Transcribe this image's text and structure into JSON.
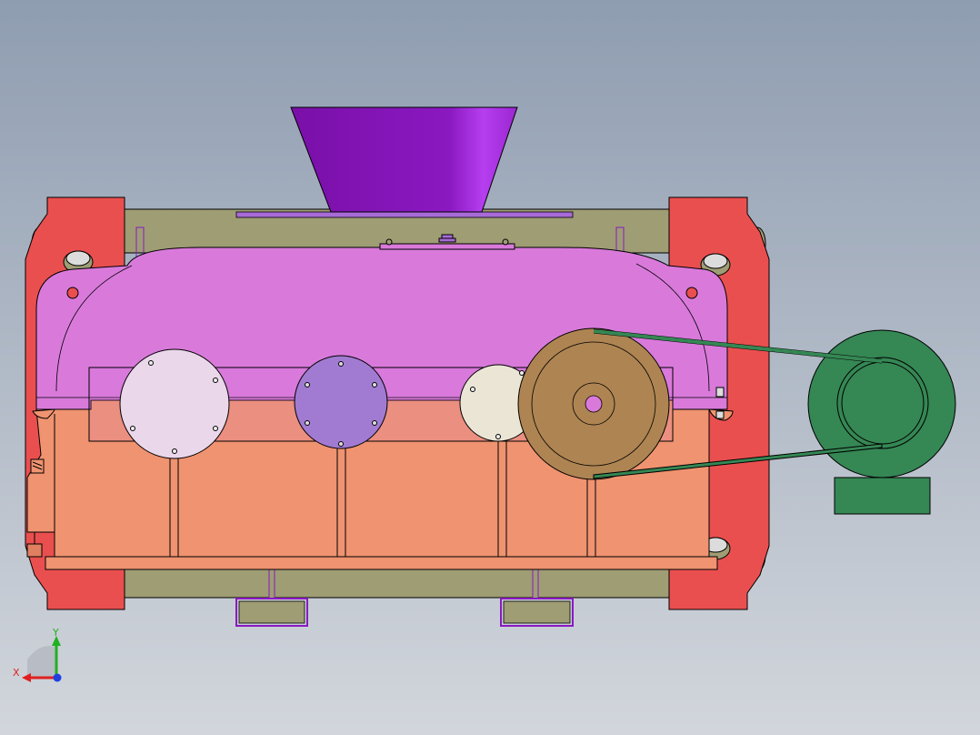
{
  "viewport": {
    "background_top": "#8f9db1",
    "background_bottom": "#d2d6dc"
  },
  "model": {
    "parts": {
      "hopper": {
        "color": "#8a19c1"
      },
      "frame_side": {
        "color": "#ea4f4f"
      },
      "frame_back": {
        "color": "#9e9d74"
      },
      "gearbox_upper": {
        "color": "#d97adb"
      },
      "gearbox_lower": {
        "color": "#ef9370"
      },
      "front_panel": {
        "color": "#f0b6ab"
      },
      "cover_large": {
        "color": "#ead7ea"
      },
      "cover_medium": {
        "color": "#a17bd2"
      },
      "cover_small": {
        "color": "#ebe5d6"
      },
      "pulley": {
        "color": "#ae8452"
      },
      "motor": {
        "color": "#358754"
      },
      "belt": {
        "color": "#358754"
      },
      "feet": {
        "color": "#9e9d74"
      }
    }
  },
  "triad": {
    "x_label": "X",
    "y_label": "Y",
    "x_color": "#e02020",
    "y_color": "#20b020",
    "z_color": "#2040e0"
  }
}
